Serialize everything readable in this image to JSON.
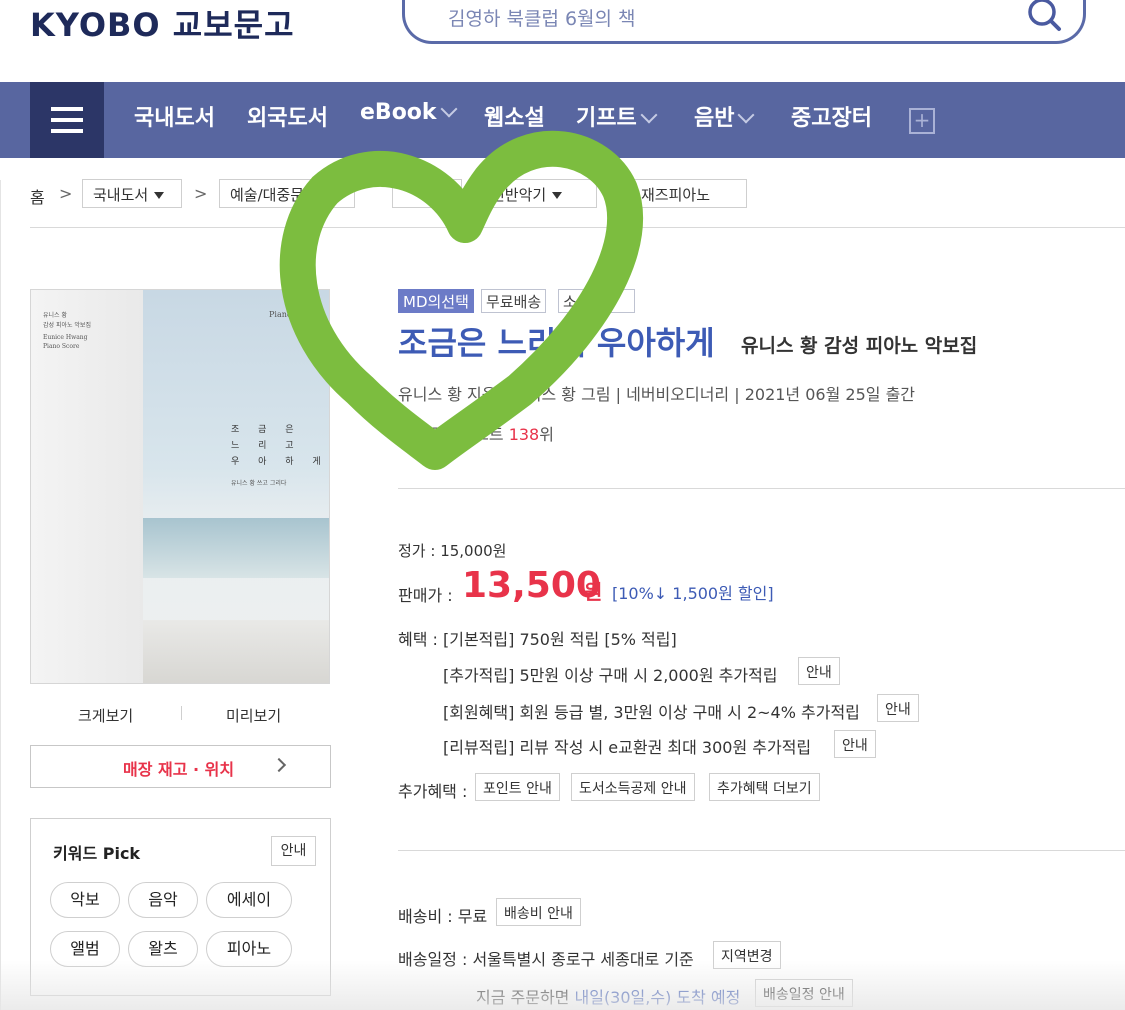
{
  "header": {
    "logo": "KYOBO 교보문고",
    "search_placeholder": "김영하 북클럽 6월의 책"
  },
  "nav": {
    "items": [
      {
        "label": "국내도서",
        "dropdown": false
      },
      {
        "label": "외국도서",
        "dropdown": false
      },
      {
        "label": "eBook",
        "dropdown": true
      },
      {
        "label": "웹소설",
        "dropdown": false
      },
      {
        "label": "기프트",
        "dropdown": true
      },
      {
        "label": "음반",
        "dropdown": true
      },
      {
        "label": "중고장터",
        "dropdown": false
      }
    ],
    "plus": "+"
  },
  "breadcrumb": {
    "home": "홈",
    "sep": ">",
    "level1": "국내도서",
    "level2": "예술/대중문화",
    "level4": "건반악기",
    "level5": "재즈피아노"
  },
  "cover": {
    "top_left_1": "유니스 황",
    "top_left_2": "감성 피아노 악보집",
    "top_left_3": "Eunice Hwang",
    "top_left_4": "Piano Score",
    "top_right": "Piano",
    "title_lines": [
      "조 금 은",
      "느 리 고",
      "우 아 하 게"
    ],
    "author": "유니스 황 쓰고 그리다"
  },
  "cover_actions": {
    "zoom": "크게보기",
    "preview": "미리보기",
    "store": "매장 재고 · 위치"
  },
  "keyword_pick": {
    "title": "키워드 Pick",
    "guide": "안내",
    "chips": [
      "악보",
      "음악",
      "에세이",
      "앨범",
      "왈츠",
      "피아노"
    ]
  },
  "product": {
    "tags": [
      "MD의선택",
      "무료배송",
      "소"
    ],
    "title": "조금은 느리게 우아하게",
    "subtitle": "유니스 황 감성 피아노 악보집",
    "author_line": "유니스 황 지음 | 유니스 황 그림 | 네버비오디너리 | 2021년 06월 25일 출간",
    "best_prefix": "주간베스트 ",
    "best_rank": "138",
    "best_suffix": "위"
  },
  "price": {
    "list_label": "정가 : 15,000원",
    "sale_label": "판매가 :",
    "sale_value": "13,500",
    "sale_unit": "원",
    "discount": "[10%↓ 1,500원 할인]"
  },
  "benefits": {
    "label": "혜택 : [기본적립] 750원 적립 [5% 적립]",
    "lines": [
      {
        "text": "[추가적립] 5만원 이상 구매 시 2,000원 추가적립",
        "button": "안내"
      },
      {
        "text": "[회원혜택] 회원 등급 별, 3만원 이상 구매 시 2~4% 추가적립",
        "button": "안내"
      },
      {
        "text": "[리뷰적립] 리뷰 작성 시 e교환권 최대 300원 추가적립",
        "button": "안내"
      }
    ],
    "extra_label": "추가혜택 :",
    "extra_buttons": [
      "포인트 안내",
      "도서소득공제 안내",
      "추가혜택 더보기"
    ]
  },
  "shipping": {
    "fee_label": "배송비 : 무료",
    "fee_button": "배송비 안내",
    "schedule_label": "배송일정 : 서울특별시 종로구 세종대로 기준",
    "schedule_button": "지역변경",
    "eta_prefix": "지금 주문하면 ",
    "eta_value": "내일(30일,수) 도착 예정",
    "eta_button": "배송일정 안내"
  },
  "colors": {
    "nav_bg": "#5866a0",
    "menu_bg": "#2c3667",
    "title_blue": "#3d5bb5",
    "price_red": "#e8334a",
    "heart_green": "#7cbd3f"
  }
}
